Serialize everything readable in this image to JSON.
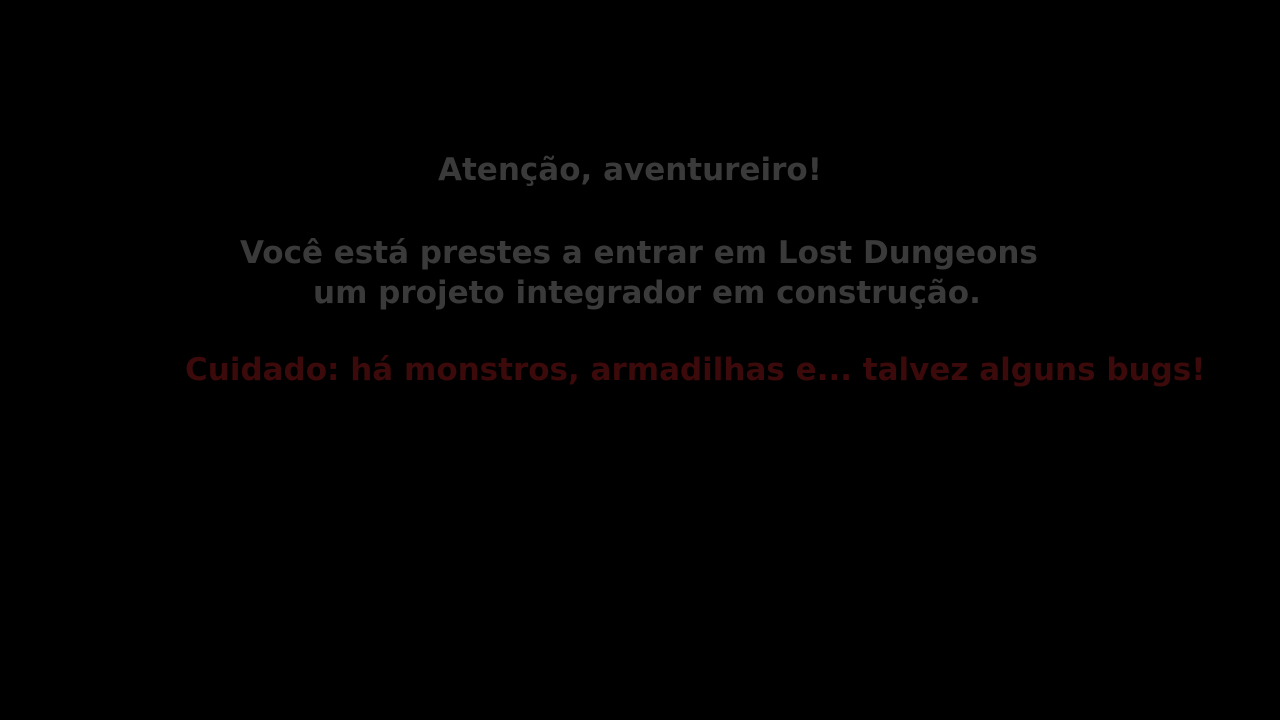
{
  "intro_screen": {
    "title": "Atenção, aventureiro!",
    "message_line_1": "Você está prestes a entrar em Lost Dungeons",
    "message_line_2": "um projeto integrador em construção.",
    "warning": "Cuidado: há monstros, armadilhas e... talvez alguns bugs!"
  },
  "colors": {
    "background": "#000000",
    "text": "#3a3a3a",
    "warning_text": "#3c0a0a"
  }
}
